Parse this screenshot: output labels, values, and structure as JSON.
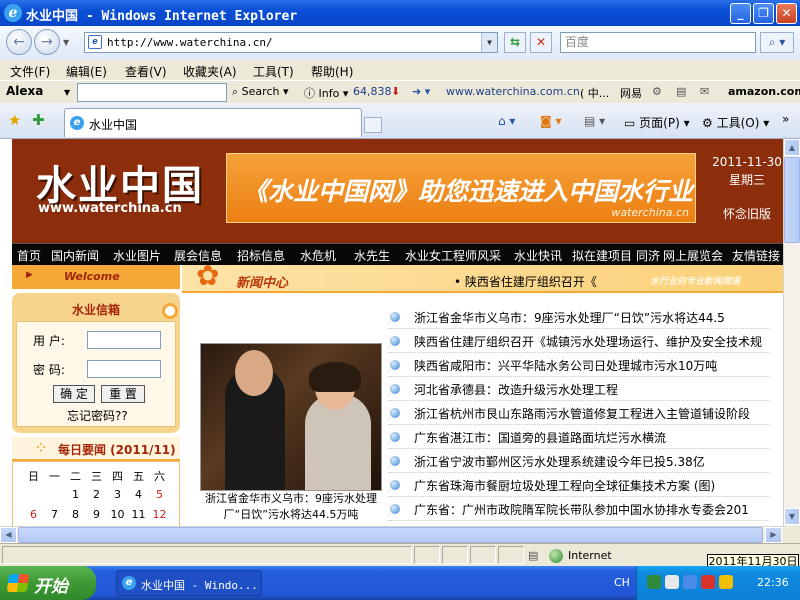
{
  "window": {
    "title": "水业中国 - Windows Internet Explorer"
  },
  "address": {
    "url": "http://www.waterchina.cn/"
  },
  "search": {
    "placeholder": "百度"
  },
  "menu": [
    "文件(F)",
    "编辑(E)",
    "查看(V)",
    "收藏夹(A)",
    "工具(T)",
    "帮助(H)"
  ],
  "alexa": {
    "logo": "Alexa",
    "search": "Search",
    "info": "Info",
    "rank": "64,838",
    "site": "www.waterchina.com.cn",
    "sitesuffix": "( 中...",
    "wangyi": "网易",
    "amazon": "amazon.com."
  },
  "tab": {
    "title": "水业中国",
    "page_label": "页面(P)",
    "tools_label": "工具(O)"
  },
  "banner": {
    "logo": "水业中国",
    "logo_sub": "www.waterchina.cn",
    "ad_text": "《水业中国网》助您迅速进入中国水行业",
    "ad_url": "waterchina.cn",
    "date": "2011-11-30",
    "weekday": "星期三",
    "old_version": "怀念旧版"
  },
  "nav": [
    "首页",
    "国内新闻",
    "水业图片",
    "展会信息",
    "招标信息",
    "水危机",
    "水先生",
    "水业女工程师风采",
    "水业快讯",
    "拟在建项目",
    "同济",
    "网上展览会",
    "友情链接"
  ],
  "welcome": "Welcome",
  "login": {
    "title": "水业信箱",
    "user_label": "用  户:",
    "pass_label": "密  码:",
    "ok_button": "确 定",
    "reset_button": "重 置",
    "forgot": "忘记密码??"
  },
  "daily": {
    "title": "每日要闻 (2011/11)"
  },
  "calendar": {
    "weekdays": [
      "日",
      "一",
      "二",
      "三",
      "四",
      "五",
      "六"
    ],
    "row1": [
      "",
      "",
      "1",
      "2",
      "3",
      "4",
      "5"
    ],
    "row2": [
      "6",
      "7",
      "8",
      "9",
      "10",
      "11",
      "12"
    ]
  },
  "newscenter": {
    "title": "新闻中心",
    "marquee": "• 陕西省住建厅组织召开《",
    "slogan": "水行业的专业新闻频道"
  },
  "photo": {
    "caption": "浙江省金华市义乌市：9座污水处理厂“日饮”污水将达44.5万吨"
  },
  "news": [
    "浙江省金华市义乌市：9座污水处理厂“日饮”污水将达44.5",
    "陕西省住建厅组织召开《城镇污水处理场运行、维护及安全技术规",
    "陕西省咸阳市：兴平华陆水务公司日处理城市污水10万吨",
    "河北省承德县：改造升级污水处理工程",
    "浙江省杭州市艮山东路雨污水管道修复工程进入主管道铺设阶段",
    "广东省湛江市：国道旁的县道路面坑烂污水横流",
    "浙江省宁波市鄞州区污水处理系统建设今年已投5.38亿",
    "广东省珠海市餐厨垃圾处理工程向全球征集技术方案 (图)",
    "广东省：广州市政院隋军院长带队参加中国水协排水专委会201"
  ],
  "status": {
    "zone": "Internet",
    "tooltip": "2011年11月30日"
  },
  "taskbar": {
    "start": "开始",
    "item": "水业中国 - Windo...",
    "lang": "CH",
    "clock": "22:36"
  }
}
